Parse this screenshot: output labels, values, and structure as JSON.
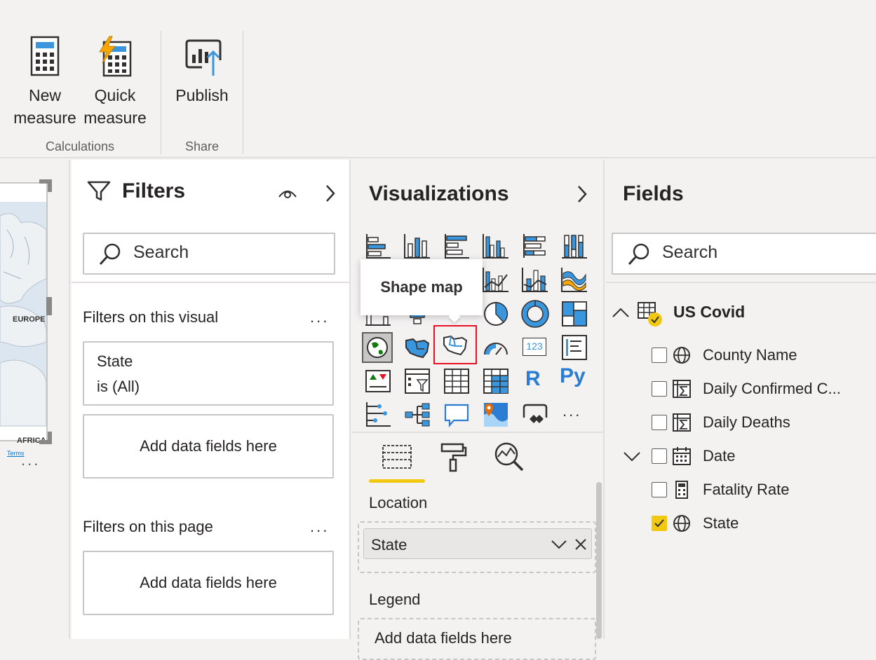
{
  "ribbon": {
    "new_measure": "New\nmeasure",
    "quick_measure": "Quick\nmeasure",
    "publish": "Publish",
    "group_calculations": "Calculations",
    "group_share": "Share"
  },
  "canvas": {
    "map_label_europe": "EUROPE",
    "map_label_africa": "AFRICA",
    "map_terms": "Terms",
    "more": "..."
  },
  "filters": {
    "title": "Filters",
    "search_placeholder": "Search",
    "section_visual": "Filters on this visual",
    "visual_card_field": "State",
    "visual_card_value": "is (All)",
    "add_fields_1": "Add data fields here",
    "section_page": "Filters on this page",
    "add_fields_2": "Add data fields here",
    "more": "..."
  },
  "visualizations": {
    "title": "Visualizations",
    "tooltip": "Shape map",
    "selected": "Shape map",
    "r_label": "R",
    "py_label": "Py",
    "kpi_label": "123",
    "more": "...",
    "section_location": "Location",
    "location_value": "State",
    "section_legend": "Legend",
    "legend_placeholder": "Add data fields here",
    "accent": "#f2c811"
  },
  "fields": {
    "title": "Fields",
    "search_placeholder": "Search",
    "table_name": "US Covid",
    "items": [
      {
        "label": "County Name",
        "checked": false,
        "icon": "globe-icon"
      },
      {
        "label": "Daily Confirmed C...",
        "checked": false,
        "icon": "sigma-table-icon"
      },
      {
        "label": "Daily Deaths",
        "checked": false,
        "icon": "sigma-table-icon"
      },
      {
        "label": "Date",
        "checked": false,
        "icon": "calendar-icon"
      },
      {
        "label": "Fatality Rate",
        "checked": false,
        "icon": "calculator-icon"
      },
      {
        "label": "State",
        "checked": true,
        "icon": "globe-icon"
      }
    ]
  }
}
